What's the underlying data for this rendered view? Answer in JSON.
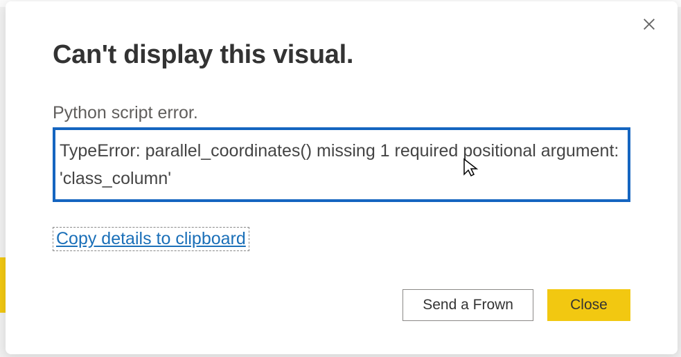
{
  "dialog": {
    "title": "Can't display this visual.",
    "error_label": "Python script error.",
    "error_message": "TypeError: parallel_coordinates() missing 1 required positional argument: 'class_column'",
    "copy_link": "Copy details to clipboard",
    "send_frown": "Send a Frown",
    "close": "Close"
  },
  "icons": {
    "close_x": "close-icon",
    "cursor": "cursor-icon"
  },
  "colors": {
    "accent": "#f2c811",
    "highlight_border": "#1565c0",
    "link": "#1a6fb8"
  }
}
